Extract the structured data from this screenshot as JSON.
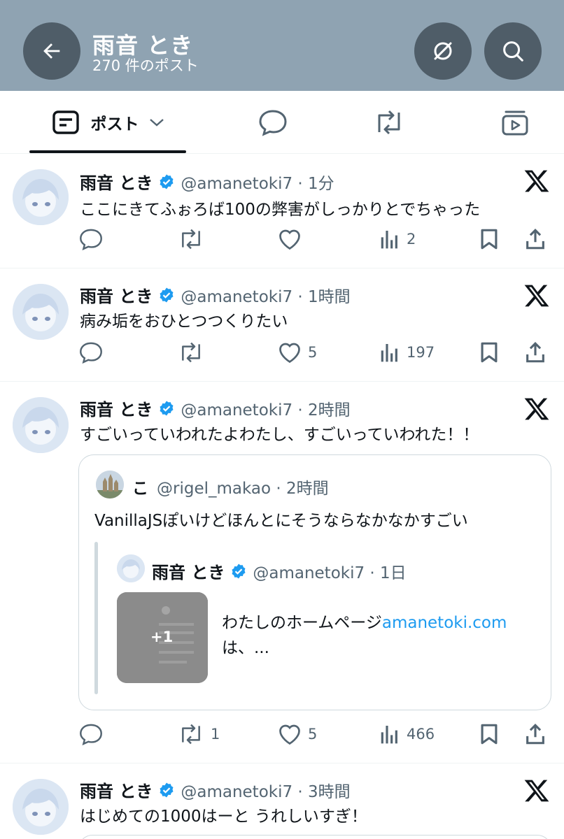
{
  "header": {
    "title": "雨音 とき",
    "subtitle": "270 件のポスト"
  },
  "tabs": {
    "posts_label": "ポスト"
  },
  "posts": [
    {
      "name": "雨音 とき",
      "handle": "@amanetoki7 · 1分",
      "text": "ここにきてふぉろば100の弊害がしっかりとでちゃった",
      "replies": "",
      "reposts": "",
      "likes": "",
      "views": "2"
    },
    {
      "name": "雨音 とき",
      "handle": "@amanetoki7 · 1時間",
      "text": "病み垢をおひとつつくりたい",
      "replies": "",
      "reposts": "",
      "likes": "5",
      "views": "197"
    },
    {
      "name": "雨音 とき",
      "handle": "@amanetoki7 · 2時間",
      "text": "すごいっていわれたよわたし、すごいっていわれた！！",
      "replies": "",
      "reposts": "1",
      "likes": "5",
      "views": "466",
      "quote": {
        "name": "こ",
        "handle": "@rigel_makao · 2時間",
        "text": "VanillaJSぽいけどほんとにそうならなかなかすごい",
        "nested": {
          "name": "雨音 とき",
          "handle": "@amanetoki7 · 1日",
          "media_count": "+1",
          "text_before": "わたしのホームページ",
          "link": "amanetoki.com",
          "text_after": "は、..."
        }
      }
    },
    {
      "name": "雨音 とき",
      "handle": "@amanetoki7 · 3時間",
      "text": "はじめての1000はーと うれしいすぎ！"
    }
  ],
  "colors": {
    "header_bg": "#8fa3b2",
    "button_bg": "#4f5d68",
    "verified": "#1d9bf0",
    "link": "#1d9bf0",
    "muted": "#536471"
  }
}
